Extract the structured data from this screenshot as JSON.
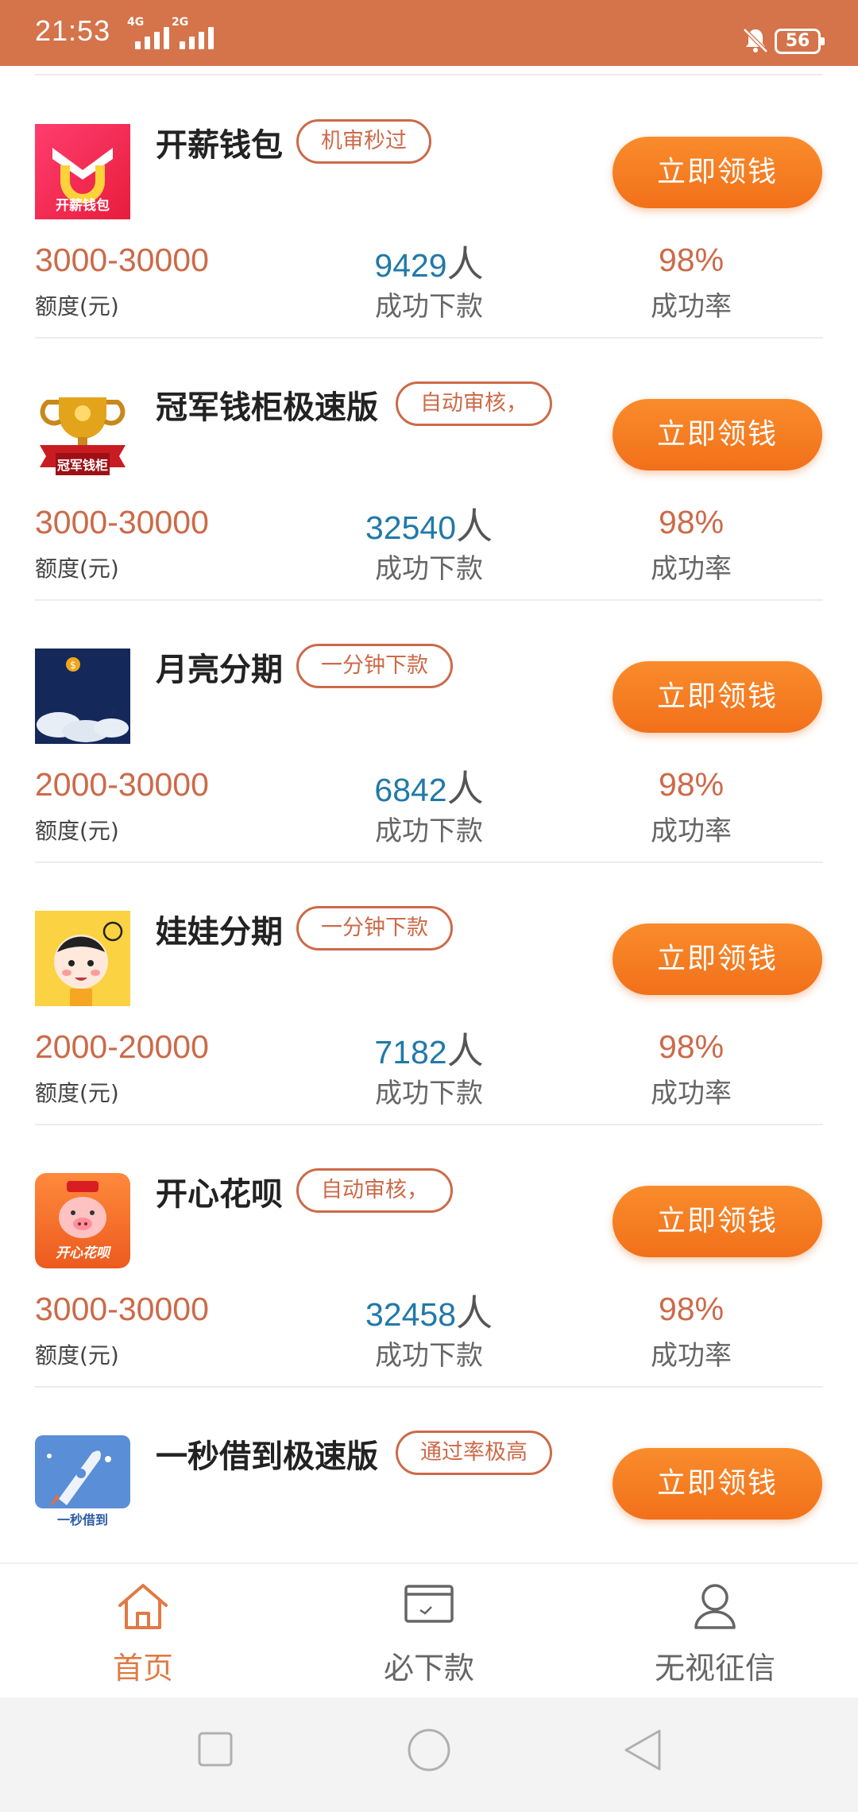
{
  "status_bar": {
    "time": "21:53",
    "network1": "4G",
    "network2": "2G",
    "battery": "56"
  },
  "colors": {
    "status_bar": "#d5734b",
    "accent": "#f37a22",
    "amount": "#cc6a49",
    "count": "#2179a8"
  },
  "list": {
    "items": [
      {
        "name": "开薪钱包",
        "tag": "机审秒过",
        "button": "立即领钱",
        "amount": "3000-30000",
        "amount_label": "额度(元)",
        "count": "9429",
        "count_unit": "人",
        "count_label": "成功下款",
        "rate": "98%",
        "rate_label": "成功率",
        "logo_text": "开薪钱包",
        "logo_icon": "wallet-logo-icon"
      },
      {
        "name": "冠军钱柜极速版",
        "tag": "自动审核，",
        "button": "立即领钱",
        "amount": "3000-30000",
        "amount_label": "额度(元)",
        "count": "32540",
        "count_unit": "人",
        "count_label": "成功下款",
        "rate": "98%",
        "rate_label": "成功率",
        "logo_text": "冠军钱柜",
        "logo_icon": "trophy-logo-icon"
      },
      {
        "name": "月亮分期",
        "tag": "一分钟下款",
        "button": "立即领钱",
        "amount": "2000-30000",
        "amount_label": "额度(元)",
        "count": "6842",
        "count_unit": "人",
        "count_label": "成功下款",
        "rate": "98%",
        "rate_label": "成功率",
        "logo_text": "",
        "logo_icon": "moon-logo-icon"
      },
      {
        "name": "娃娃分期",
        "tag": "一分钟下款",
        "button": "立即领钱",
        "amount": "2000-20000",
        "amount_label": "额度(元)",
        "count": "7182",
        "count_unit": "人",
        "count_label": "成功下款",
        "rate": "98%",
        "rate_label": "成功率",
        "logo_text": "",
        "logo_icon": "baby-logo-icon"
      },
      {
        "name": "开心花呗",
        "tag": "自动审核，",
        "button": "立即领钱",
        "amount": "3000-30000",
        "amount_label": "额度(元)",
        "count": "32458",
        "count_unit": "人",
        "count_label": "成功下款",
        "rate": "98%",
        "rate_label": "成功率",
        "logo_text": "开心花呗",
        "logo_icon": "pig-logo-icon"
      },
      {
        "name": "一秒借到极速版",
        "tag": "通过率极高",
        "button": "立即领钱",
        "amount": "",
        "amount_label": "",
        "count": "",
        "count_unit": "",
        "count_label": "",
        "rate": "",
        "rate_label": "",
        "logo_text": "一秒借到",
        "logo_icon": "rocket-logo-icon"
      }
    ]
  },
  "bottom_nav": {
    "items": [
      {
        "label": "首页",
        "icon": "home-icon",
        "active": true
      },
      {
        "label": "必下款",
        "icon": "card-icon",
        "active": false
      },
      {
        "label": "无视征信",
        "icon": "user-icon",
        "active": false
      }
    ]
  },
  "system_nav": {
    "icons": [
      "square-icon",
      "circle-icon",
      "back-triangle-icon"
    ]
  }
}
